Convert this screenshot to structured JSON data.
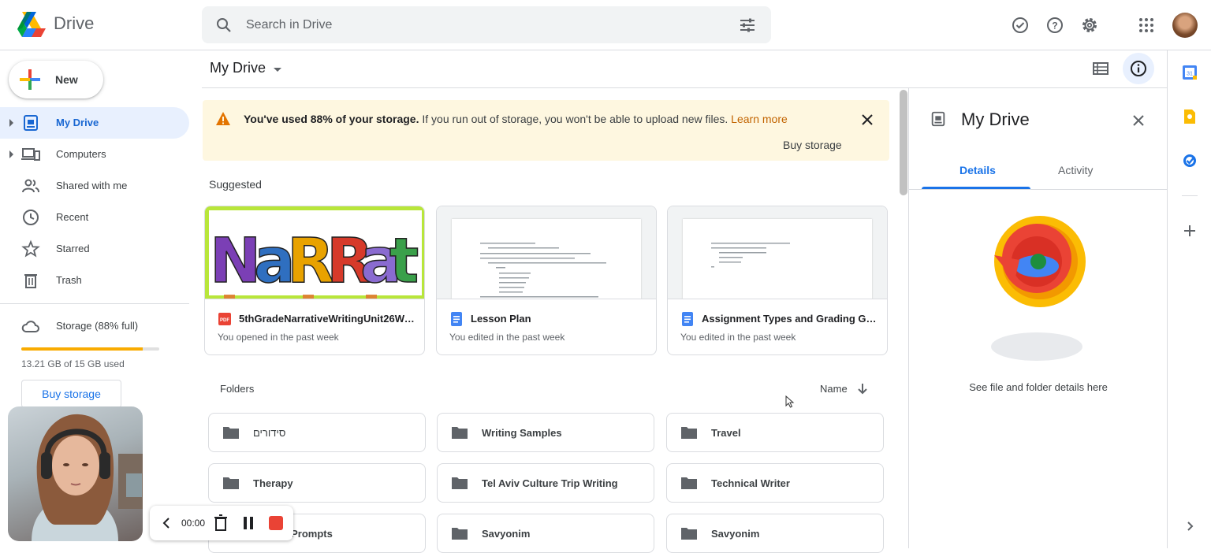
{
  "app": {
    "title": "Drive"
  },
  "search": {
    "placeholder": "Search in Drive"
  },
  "sidebar": {
    "new_label": "New",
    "items": [
      {
        "label": "My Drive",
        "icon": "my-drive-icon"
      },
      {
        "label": "Computers",
        "icon": "computer-icon"
      },
      {
        "label": "Shared with me",
        "icon": "people-icon"
      },
      {
        "label": "Recent",
        "icon": "clock-icon"
      },
      {
        "label": "Starred",
        "icon": "star-icon"
      },
      {
        "label": "Trash",
        "icon": "trash-icon"
      }
    ],
    "storage": {
      "label": "Storage (88% full)",
      "used_text": "13.21 GB of 15 GB used",
      "fraction": 0.88,
      "buy_label": "Buy storage"
    }
  },
  "main": {
    "title": "My Drive",
    "banner": {
      "bold": "You've used 88% of your storage.",
      "text": " If you run out of storage, you won't be able to upload new files. ",
      "link": "Learn more",
      "buy_label": "Buy storage"
    },
    "suggested_label": "Suggested",
    "suggested": [
      {
        "name": "5thGradeNarrativeWritingUnit26We...",
        "sub": "You opened in the past week",
        "type": "pdf",
        "thumb_text": "NaRRative"
      },
      {
        "name": "Lesson Plan",
        "sub": "You edited in the past week",
        "type": "doc"
      },
      {
        "name": "Assignment Types and Grading Gui...",
        "sub": "You edited in the past week",
        "type": "doc"
      }
    ],
    "folders_label": "Folders",
    "sort_label": "Name",
    "folders": [
      {
        "name": "סידורים"
      },
      {
        "name": "Writing Samples"
      },
      {
        "name": "Travel"
      },
      {
        "name": "Therapy"
      },
      {
        "name": "Tel Aviv Culture Trip Writing"
      },
      {
        "name": "Technical Writer"
      },
      {
        "name": "Writing Prompts"
      },
      {
        "name": "Savyonim"
      },
      {
        "name": "Savyonim"
      }
    ]
  },
  "panel": {
    "title": "My Drive",
    "tabs": [
      {
        "label": "Details"
      },
      {
        "label": "Activity"
      }
    ],
    "hint": "See file and folder details here"
  },
  "recorder": {
    "time": "00:00"
  },
  "colors": {
    "accent": "#1a73e8",
    "warning": "#f9ab00",
    "banner_bg": "#fef7e0",
    "active_nav_bg": "#e8f0fe"
  }
}
